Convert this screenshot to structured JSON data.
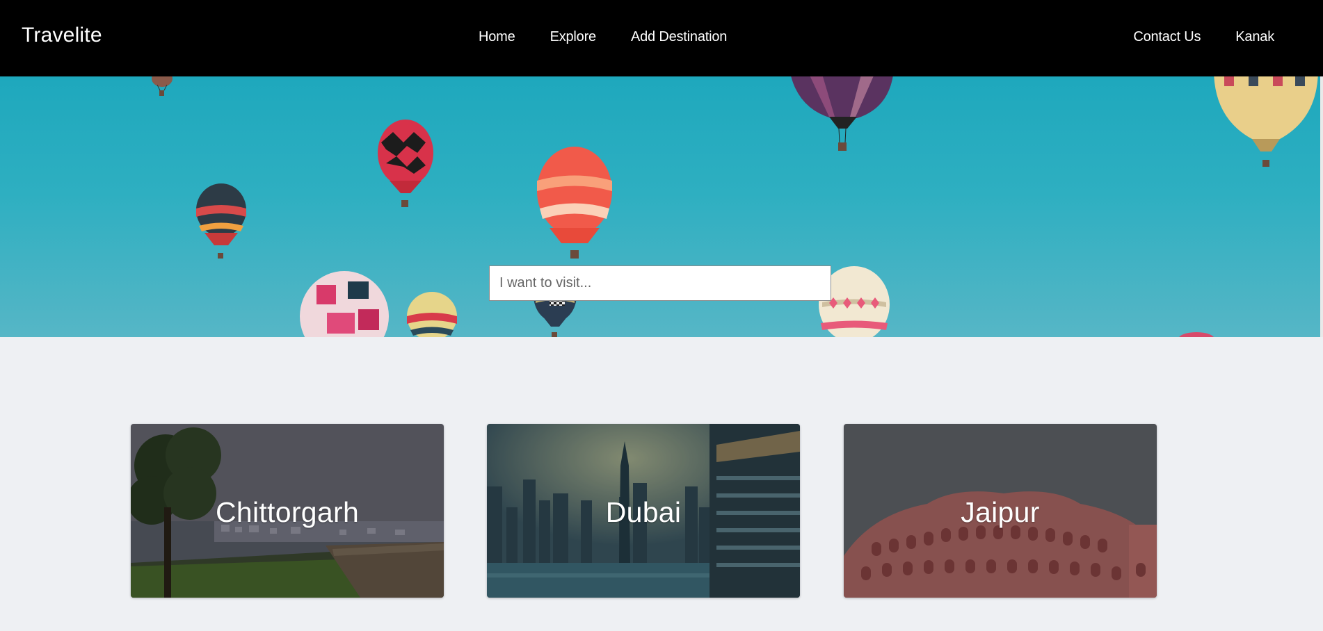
{
  "navbar": {
    "brand": "Travelite",
    "links": [
      {
        "label": "Home"
      },
      {
        "label": "Explore"
      },
      {
        "label": "Add Destination"
      }
    ],
    "right_links": [
      {
        "label": "Contact Us"
      },
      {
        "label": "Kanak"
      }
    ]
  },
  "hero": {
    "search_placeholder": "I want to visit..."
  },
  "destinations": [
    {
      "name": "Chittorgarh"
    },
    {
      "name": "Dubai"
    },
    {
      "name": "Jaipur"
    }
  ],
  "colors": {
    "navbar_bg": "#000000",
    "sky": "#2eafc1",
    "page_bg": "#eef0f3"
  }
}
